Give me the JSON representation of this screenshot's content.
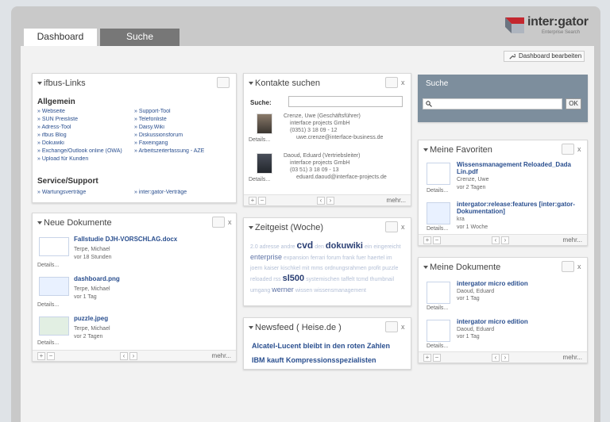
{
  "brand": {
    "name": "inter:gator",
    "subtitle": "Enterprise Search"
  },
  "tabs": [
    {
      "label": "Dashboard"
    },
    {
      "label": "Suche"
    }
  ],
  "toolbar": {
    "edit_dashboard_label": "Dashboard bearbeiten"
  },
  "panels": {
    "ifbus_links": {
      "title": "ifbus-Links",
      "allgemein_heading": "Allgemein",
      "allgemein_links": [
        "Webseite",
        "Support-Tool",
        "SUN Preisliste",
        "Telefonliste",
        "Adress-Tool",
        "Daisy.Wiki",
        "ifbus Blog",
        "Diskussionsforum",
        "Dokuwiki",
        "Faxeingang",
        "Exchange/Outlook online (OWA)",
        "Arbeitszeiterfassung - AZE",
        "Upload für Kunden"
      ],
      "service_heading": "Service/Support",
      "service_links": [
        "Wartungsverträge",
        "inter:gator-Verträge"
      ]
    },
    "neue_dokumente": {
      "title": "Neue Dokumente",
      "items": [
        {
          "name": "Fallstudie DJH-VORSCHLAG.docx",
          "author": "Terpe, Michael",
          "time": "vor 18 Stunden",
          "details": "Details..."
        },
        {
          "name": "dashboard.png",
          "author": "Terpe, Michael",
          "time": "vor 1 Tag",
          "details": "Details..."
        },
        {
          "name": "puzzle.jpeg",
          "author": "Terpe, Michael",
          "time": "vor 2 Tagen",
          "details": "Details..."
        }
      ],
      "more": "mehr..."
    },
    "kontakte": {
      "title": "Kontakte suchen",
      "search_label": "Suche:",
      "search_value": "",
      "contacts": [
        {
          "name": "Crenze, Uwe (Geschäftsführer)",
          "company": "interface projects GmbH",
          "phone": "(0351) 3 18 09 - 12",
          "email": "uwe.crenze@interface-business.de",
          "details": "Details..."
        },
        {
          "name": "Daoud, Eduard (Vertriebsleiter)",
          "company": "interface projects GmbH",
          "phone": "(03 51) 3 18 09 - 13",
          "email": "eduard.daoud@interface-projects.de",
          "details": "Details..."
        }
      ],
      "more": "mehr..."
    },
    "zeitgeist": {
      "title": "Zeitgeist (Woche)",
      "words": [
        {
          "t": "2.0",
          "s": 7,
          "c": "#b3bfd6"
        },
        {
          "t": "adresse",
          "s": 7,
          "c": "#b3bfd6"
        },
        {
          "t": "andre",
          "s": 7,
          "c": "#b3bfd6"
        },
        {
          "t": "cvd",
          "s": 12,
          "c": "#2a3f74",
          "b": true
        },
        {
          "t": "den",
          "s": 7,
          "c": "#b3bfd6"
        },
        {
          "t": "dokuwiki",
          "s": 11,
          "c": "#2a3f74",
          "b": true
        },
        {
          "t": "ein",
          "s": 7,
          "c": "#b3bfd6"
        },
        {
          "t": "eingereicht",
          "s": 7,
          "c": "#b3bfd6"
        },
        {
          "t": "enterprise",
          "s": 9,
          "c": "#5e73a6"
        },
        {
          "t": "expansion",
          "s": 7,
          "c": "#b3bfd6"
        },
        {
          "t": "ferrari",
          "s": 7,
          "c": "#b3bfd6"
        },
        {
          "t": "forum",
          "s": 7,
          "c": "#b3bfd6"
        },
        {
          "t": "frank",
          "s": 7,
          "c": "#b3bfd6"
        },
        {
          "t": "fuer",
          "s": 7,
          "c": "#b3bfd6"
        },
        {
          "t": "haertel",
          "s": 7,
          "c": "#b3bfd6"
        },
        {
          "t": "im",
          "s": 7,
          "c": "#b3bfd6"
        },
        {
          "t": "joern",
          "s": 7,
          "c": "#b3bfd6"
        },
        {
          "t": "kaiser",
          "s": 7,
          "c": "#b3bfd6"
        },
        {
          "t": "kischkel",
          "s": 7,
          "c": "#b3bfd6"
        },
        {
          "t": "mit",
          "s": 7,
          "c": "#b3bfd6"
        },
        {
          "t": "mms",
          "s": 7,
          "c": "#b3bfd6"
        },
        {
          "t": "ordnungsrahmen",
          "s": 7,
          "c": "#b3bfd6"
        },
        {
          "t": "profit",
          "s": 7,
          "c": "#b3bfd6"
        },
        {
          "t": "puzzle",
          "s": 7,
          "c": "#b3bfd6"
        },
        {
          "t": "reloaded",
          "s": 7,
          "c": "#b3bfd6"
        },
        {
          "t": "rss",
          "s": 7,
          "c": "#b3bfd6"
        },
        {
          "t": "sl500",
          "s": 11,
          "c": "#2a3f74",
          "b": true
        },
        {
          "t": "systemischen",
          "s": 7,
          "c": "#b3bfd6"
        },
        {
          "t": "taffelt",
          "s": 7,
          "c": "#b3bfd6"
        },
        {
          "t": "tcmd",
          "s": 7,
          "c": "#b3bfd6"
        },
        {
          "t": "thumbnail",
          "s": 7,
          "c": "#b3bfd6"
        },
        {
          "t": "umgang",
          "s": 7,
          "c": "#b3bfd6"
        },
        {
          "t": "werner",
          "s": 9,
          "c": "#5e73a6"
        },
        {
          "t": "wissen",
          "s": 7,
          "c": "#b3bfd6"
        },
        {
          "t": "wissensmanagement",
          "s": 7,
          "c": "#b3bfd6"
        }
      ]
    },
    "newsfeed": {
      "title": "Newsfeed ( Heise.de )",
      "items": [
        "Alcatel-Lucent bleibt in den roten Zahlen",
        "IBM kauft Kompressionsspezialisten"
      ]
    },
    "suche": {
      "title": "Suche",
      "search_value": "",
      "ok_label": "OK"
    },
    "favoriten": {
      "title": "Meine Favoriten",
      "items": [
        {
          "name": "Wissensmanagement Reloaded_Dada Lin.pdf",
          "author": "Crenze, Uwe",
          "time": "vor 2 Tagen",
          "details": "Details..."
        },
        {
          "name": "intergator:release:features [inter:gator-Dokumentation]",
          "author": "kra",
          "time": "vor 1 Woche",
          "details": "Details..."
        }
      ],
      "more": "mehr..."
    },
    "meine_dokumente": {
      "title": "Meine Dokumente",
      "items": [
        {
          "name": "intergator micro edition",
          "author": "Daoud, Eduard",
          "time": "vor 1 Tag",
          "details": "Details..."
        },
        {
          "name": "intergator micro edition",
          "author": "Daoud, Eduard",
          "time": "vor 1 Tag",
          "details": "Details..."
        }
      ],
      "more": "mehr..."
    }
  }
}
